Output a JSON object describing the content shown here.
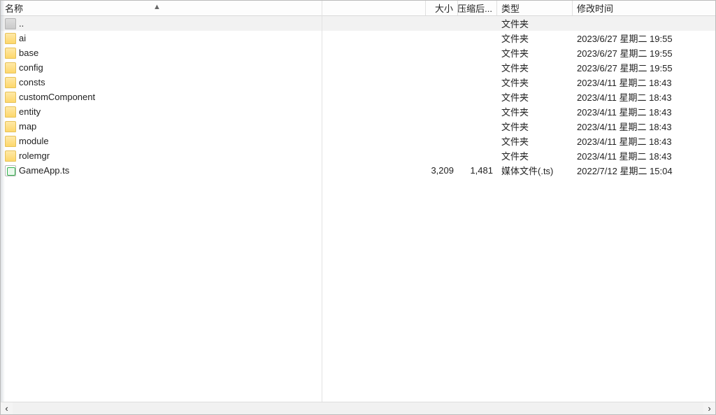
{
  "columns": {
    "name": "名称",
    "size": "大小",
    "packed": "压缩后...",
    "type": "类型",
    "modified": "修改时间"
  },
  "sort_dir_glyph": "▲",
  "rows": [
    {
      "icon": "folder-dim",
      "name": "..",
      "size": "",
      "packed": "",
      "type": "文件夹",
      "modified": "",
      "is_parent": true
    },
    {
      "icon": "folder",
      "name": "ai",
      "size": "",
      "packed": "",
      "type": "文件夹",
      "modified": "2023/6/27 星期二 19:55"
    },
    {
      "icon": "folder",
      "name": "base",
      "size": "",
      "packed": "",
      "type": "文件夹",
      "modified": "2023/6/27 星期二 19:55"
    },
    {
      "icon": "folder",
      "name": "config",
      "size": "",
      "packed": "",
      "type": "文件夹",
      "modified": "2023/6/27 星期二 19:55"
    },
    {
      "icon": "folder",
      "name": "consts",
      "size": "",
      "packed": "",
      "type": "文件夹",
      "modified": "2023/4/11 星期二 18:43"
    },
    {
      "icon": "folder",
      "name": "customComponent",
      "size": "",
      "packed": "",
      "type": "文件夹",
      "modified": "2023/4/11 星期二 18:43"
    },
    {
      "icon": "folder",
      "name": "entity",
      "size": "",
      "packed": "",
      "type": "文件夹",
      "modified": "2023/4/11 星期二 18:43"
    },
    {
      "icon": "folder",
      "name": "map",
      "size": "",
      "packed": "",
      "type": "文件夹",
      "modified": "2023/4/11 星期二 18:43"
    },
    {
      "icon": "folder",
      "name": "module",
      "size": "",
      "packed": "",
      "type": "文件夹",
      "modified": "2023/4/11 星期二 18:43"
    },
    {
      "icon": "folder",
      "name": "rolemgr",
      "size": "",
      "packed": "",
      "type": "文件夹",
      "modified": "2023/4/11 星期二 18:43"
    },
    {
      "icon": "media",
      "name": "GameApp.ts",
      "size": "3,209",
      "packed": "1,481",
      "type": "媒体文件(.ts)",
      "modified": "2022/7/12 星期二 15:04"
    }
  ],
  "scroll": {
    "left_glyph": "‹",
    "right_glyph": "›"
  }
}
